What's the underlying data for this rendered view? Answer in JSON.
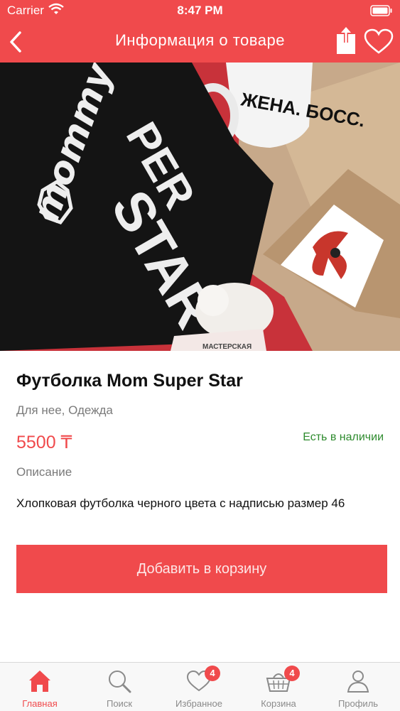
{
  "status_bar": {
    "carrier": "Carrier",
    "time": "8:47 PM"
  },
  "navbar": {
    "title": "Информация о товаре"
  },
  "product": {
    "name": "Футболка Mom Super Star",
    "category": "Для нее, Одежда",
    "price": "5500 ₸",
    "availability": "Есть в наличии",
    "description_label": "Описание",
    "description": "Хлопковая футболка черного цвета с надписью размер 46",
    "photo_text": {
      "mommy": "mommy",
      "super": "PER",
      "star": "STAR",
      "mug": "ЖЕНА. БОСС.",
      "card": "МАСТЕРСКАЯ"
    }
  },
  "add_to_cart_label": "Добавить в корзину",
  "tabs": [
    {
      "label": "Главная",
      "icon": "home-icon",
      "active": true
    },
    {
      "label": "Поиск",
      "icon": "search-icon"
    },
    {
      "label": "Избранное",
      "icon": "heart-icon",
      "badge": "4"
    },
    {
      "label": "Корзина",
      "icon": "basket-icon",
      "badge": "4"
    },
    {
      "label": "Профиль",
      "icon": "person-icon"
    }
  ],
  "colors": {
    "accent": "#f04a4c",
    "in_stock": "#2e8b2e"
  }
}
